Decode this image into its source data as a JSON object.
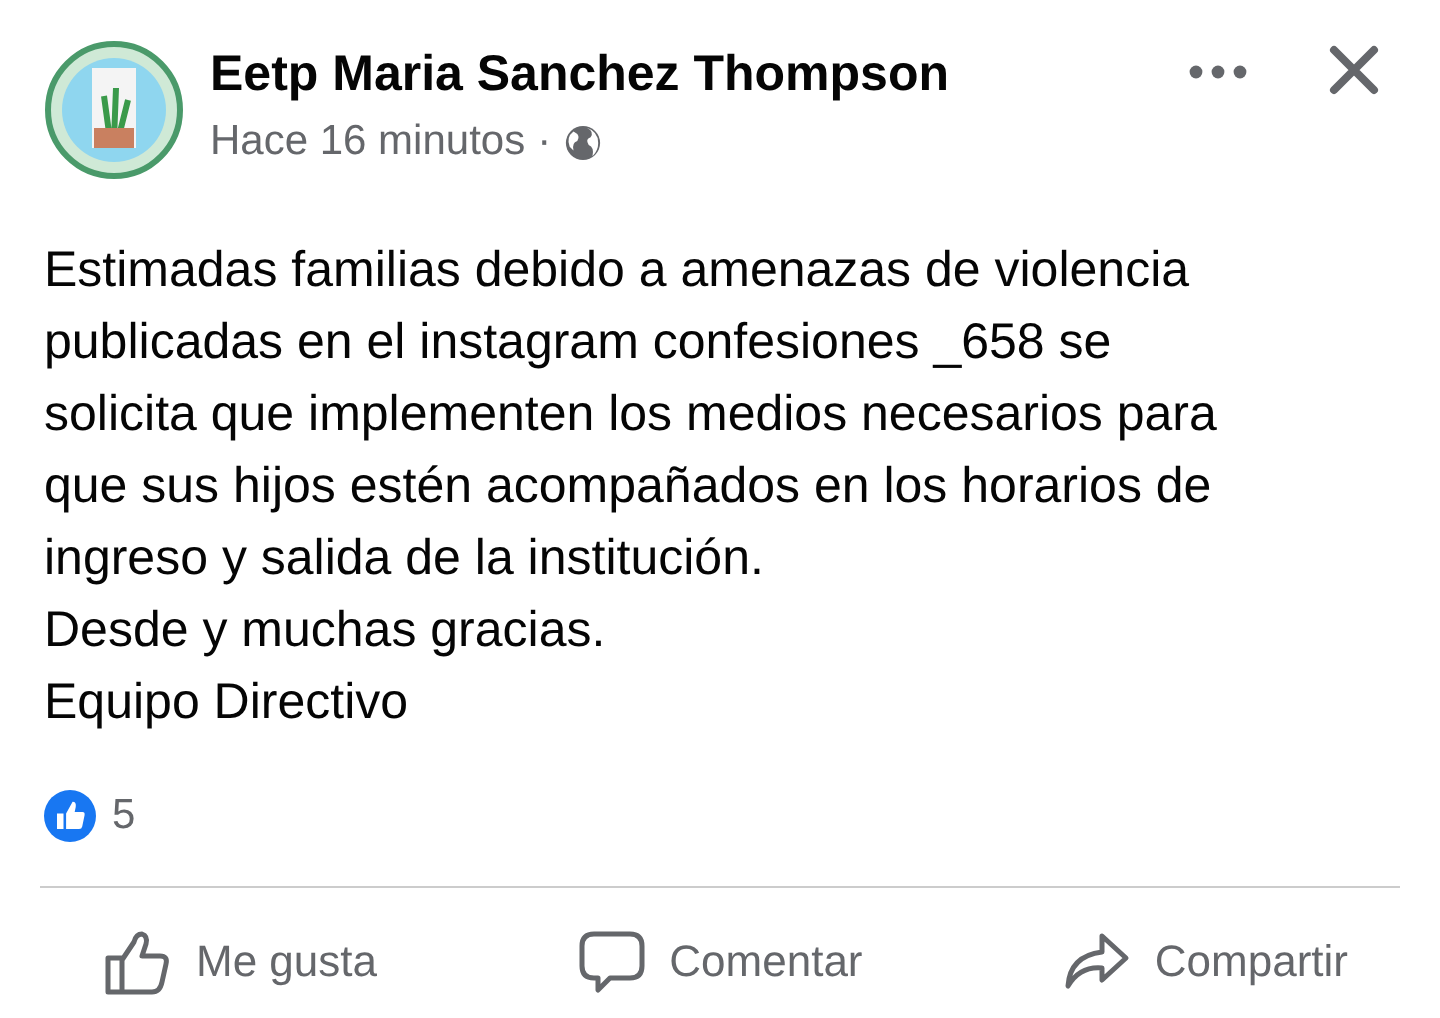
{
  "post": {
    "author": "Eetp Maria Sanchez Thompson",
    "time": "Hace 16 minutos",
    "separator": "·",
    "body_lines": [
      "Estimadas familias debido a amenazas de violencia",
      "publicadas en el instagram confesiones _658 se",
      "solicita que implementen los medios necesarios para",
      "que sus hijos estén acompañados en los horarios de",
      "ingreso y salida de la institución.",
      "Desde y muchas gracias.",
      "Equipo Directivo"
    ],
    "reaction_count": "5"
  },
  "actions": [
    {
      "kind": "like",
      "label": "Me gusta"
    },
    {
      "kind": "comment",
      "label": "Comentar"
    },
    {
      "kind": "share",
      "label": "Compartir"
    }
  ]
}
